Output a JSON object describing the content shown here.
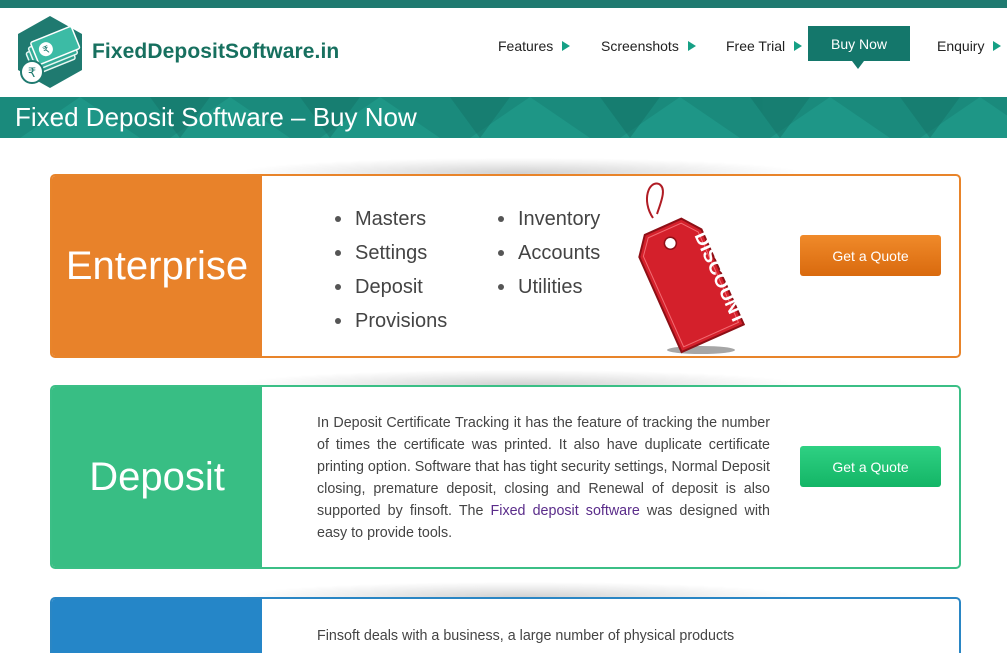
{
  "site": {
    "name": "FixedDepositSoftware.in"
  },
  "nav": {
    "items": [
      {
        "label": "Features"
      },
      {
        "label": "Screenshots"
      },
      {
        "label": "Free Trial"
      },
      {
        "label": "Buy Now"
      },
      {
        "label": "Enquiry"
      }
    ],
    "active": "Buy Now"
  },
  "banner": {
    "title": "Fixed Deposit Software – Buy Now"
  },
  "cards": [
    {
      "title": "Enterprise",
      "features_left": [
        "Masters",
        "Settings",
        "Deposit",
        "Provisions"
      ],
      "features_right": [
        "Inventory",
        "Accounts",
        "Utilities"
      ],
      "tag_label": "DISCOUNT",
      "button": "Get a Quote",
      "color": "#e8822a"
    },
    {
      "title": "Deposit",
      "description_before": "In Deposit Certificate Tracking it has the feature of tracking the number of times the certificate was printed. It also have duplicate certificate printing option. Software that has tight security settings, Normal Deposit closing, premature deposit, closing and Renewal of deposit is also supported by finsoft. The ",
      "description_link": "Fixed deposit software",
      "description_after": " was designed with easy to provide tools.",
      "button": "Get a Quote",
      "color": "#38be84"
    },
    {
      "title": "",
      "description": "Finsoft deals with a business, a large number of physical products",
      "color": "#2586c8"
    }
  ],
  "colors": {
    "brand_teal": "#1f7a70",
    "nav_active_bg": "#14776b",
    "arrow": "#16a085",
    "link": "#5a2c8a"
  },
  "icons": [
    "rupee-money-logo-icon",
    "nav-arrow-icon",
    "discount-tag-icon"
  ]
}
